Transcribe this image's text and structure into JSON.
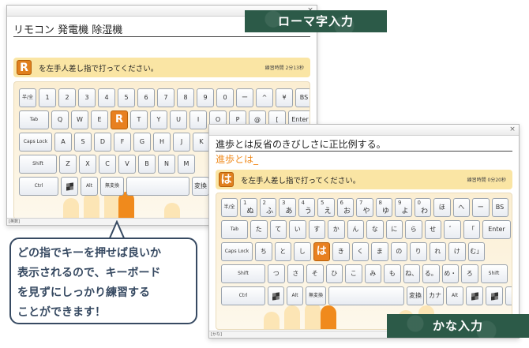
{
  "labels": {
    "romaji_mode": "ローマ字入力",
    "kana_mode": "かな入力"
  },
  "callout": {
    "lines": [
      "どの指でキーを押せば良いか",
      "表示されるので、キーボード",
      "を見ずにしっかり練習する",
      "ことができます！"
    ]
  },
  "romaji_window": {
    "close": "×",
    "words": "リモコン 発電機 除湿機",
    "instruction": {
      "key": "R",
      "text": "を左手人差し指で打ってください。",
      "timer": "練習時間 2分13秒"
    },
    "status": "[英数]",
    "rows": [
      [
        "半/全",
        "1",
        "2",
        "3",
        "4",
        "5",
        "6",
        "7",
        "8",
        "9",
        "0",
        "ー",
        "^",
        "¥",
        "BS"
      ],
      [
        "Tab",
        "Q",
        "W",
        "E",
        "R",
        "T",
        "Y",
        "U",
        "I",
        "O",
        "P",
        "@",
        "[",
        "Enter"
      ],
      [
        "Caps Lock",
        "A",
        "S",
        "D",
        "F",
        "G",
        "H",
        "J",
        "K",
        "L"
      ],
      [
        "Shift",
        "Z",
        "X",
        "C",
        "V",
        "B",
        "N",
        "M"
      ],
      [
        "Ctrl",
        "win",
        "Alt",
        "無変換",
        "",
        "変換"
      ]
    ]
  },
  "kana_window": {
    "close": "×",
    "sentence": "進歩とは反省のきびしさに正比例する。",
    "typed": "進歩とは_",
    "instruction": {
      "key": "は",
      "text": "を左手人差し指で打ってください。",
      "timer": "練習時間 0分20秒"
    },
    "status": "[かな]",
    "rows": [
      [
        "半/全",
        "1 ぬ",
        "2 ふ",
        "3 あ",
        "4 う",
        "5 え",
        "6 お",
        "7 や",
        "8 ゆ",
        "9 よ",
        "0 わ",
        "ほ",
        "へ",
        "ー",
        "BS"
      ],
      [
        "Tab",
        "た",
        "て",
        "い",
        "す",
        "か",
        "ん",
        "な",
        "に",
        "ら",
        "せ",
        "゛",
        "「",
        "Enter"
      ],
      [
        "Caps Lock",
        "ち",
        "と",
        "し",
        "は",
        "き",
        "く",
        "ま",
        "の",
        "り",
        "れ",
        "け",
        "む」"
      ],
      [
        "Shift",
        "つ",
        "さ",
        "そ",
        "ひ",
        "こ",
        "み",
        "も",
        "ね、",
        "る。",
        "め・",
        "ろ",
        "Shift"
      ],
      [
        "Ctrl",
        "win",
        "Alt",
        "無変換",
        "",
        "変換",
        "カナ",
        "Alt",
        "win",
        "menu",
        "Ctrl"
      ]
    ]
  },
  "colors": {
    "accent": "#e8801f",
    "instruction_bg": "#fae5a4",
    "label_bg": "#2c5a48",
    "callout_border": "#374a62"
  }
}
